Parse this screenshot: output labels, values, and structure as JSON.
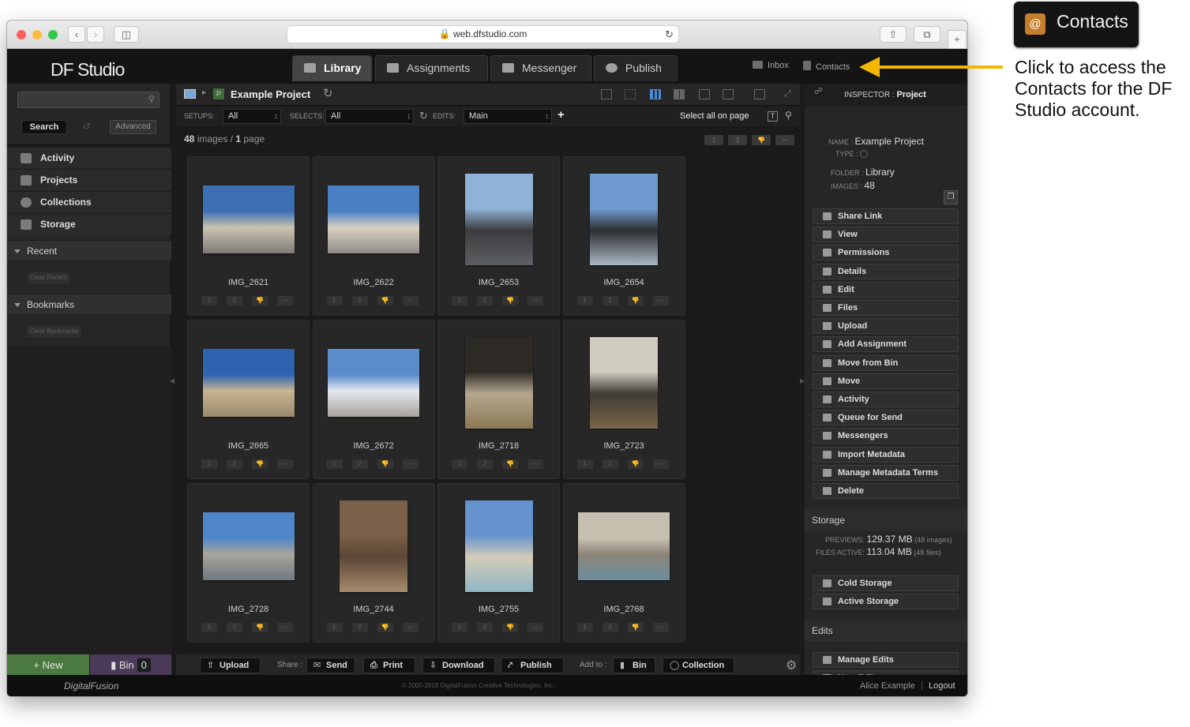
{
  "browser": {
    "url": "web.dfstudio.com"
  },
  "app": {
    "logo": "DF Studio",
    "tabs": [
      {
        "label": "Library",
        "icon": "library-icon",
        "active": true
      },
      {
        "label": "Assignments",
        "icon": "pencil-icon",
        "active": false
      },
      {
        "label": "Messenger",
        "icon": "messenger-icon",
        "active": false
      },
      {
        "label": "Publish",
        "icon": "publish-icon",
        "active": false
      }
    ],
    "inbox": "Inbox",
    "contacts": "Contacts"
  },
  "sidebar": {
    "search_button": "Search",
    "advanced_button": "Advanced",
    "nav": [
      "Activity",
      "Projects",
      "Collections",
      "Storage"
    ],
    "recent": "Recent",
    "clear_recent": "Clear Recent",
    "bookmarks": "Bookmarks",
    "clear_bookmarks": "Clear Bookmarks",
    "new_button": "+ New",
    "bin_button": "Bin",
    "bin_count": "0"
  },
  "content": {
    "project_badge": "P",
    "project_title": "Example Project",
    "setups_label": "SETUPS:",
    "setups_value": "All",
    "selects_label": "SELECTS:",
    "selects_value": "All",
    "edits_label": "EDITS:",
    "edits_value": "Main",
    "add_edit": "+",
    "select_all": "Select all on page",
    "count_images": "48",
    "count_images_label": "images",
    "count_sep": "/",
    "count_pages": "1",
    "count_pages_label": "page",
    "page_buttons": [
      "1",
      "2",
      "👎",
      "—"
    ],
    "rating_buttons": [
      "1",
      "2",
      "👎",
      "—"
    ],
    "images": [
      {
        "name": "IMG_2621",
        "orient": "l",
        "colors": [
          "#3d6fb4",
          "#c9c3b1",
          "#7d7b77"
        ]
      },
      {
        "name": "IMG_2622",
        "orient": "l",
        "colors": [
          "#4a7fc4",
          "#d8d2c2",
          "#8f8c87"
        ]
      },
      {
        "name": "IMG_2653",
        "orient": "p",
        "colors": [
          "#8fb2d6",
          "#3c3c3e",
          "#5d5f63"
        ]
      },
      {
        "name": "IMG_2654",
        "orient": "p",
        "colors": [
          "#6f9bd0",
          "#2d2e30",
          "#a9b6c3"
        ]
      },
      {
        "name": "IMG_2665",
        "orient": "l",
        "colors": [
          "#2f63b0",
          "#c8b493",
          "#9a8a6c"
        ]
      },
      {
        "name": "IMG_2672",
        "orient": "l",
        "colors": [
          "#5b8bcb",
          "#e3e9ef",
          "#a8a39a"
        ]
      },
      {
        "name": "IMG_2718",
        "orient": "p",
        "colors": [
          "#2d2a25",
          "#b5a88f",
          "#8a7754"
        ]
      },
      {
        "name": "IMG_2723",
        "orient": "p",
        "colors": [
          "#d0cbbf",
          "#3f3b34",
          "#7a6647"
        ]
      },
      {
        "name": "IMG_2728",
        "orient": "l",
        "colors": [
          "#4f86c9",
          "#a9a59b",
          "#707a80"
        ]
      },
      {
        "name": "IMG_2744",
        "orient": "p",
        "colors": [
          "#7a6048",
          "#5b4735",
          "#a88c6e"
        ]
      },
      {
        "name": "IMG_2755",
        "orient": "p",
        "colors": [
          "#6493cf",
          "#d3cbb8",
          "#8fb7c4"
        ]
      },
      {
        "name": "IMG_2768",
        "orient": "l",
        "colors": [
          "#c7c0b1",
          "#8c8578",
          "#6b8e9c"
        ]
      }
    ]
  },
  "bottombar": {
    "upload": "Upload",
    "share_label": "Share :",
    "send": "Send",
    "print": "Print",
    "download": "Download",
    "publish": "Publish",
    "add_to_label": "Add to :",
    "bin": "Bin",
    "collection": "Collection"
  },
  "inspector": {
    "title_label": "INSPECTOR :",
    "title_value": "Project",
    "name_label": "NAME :",
    "name_value": "Example Project",
    "type_label": "TYPE :",
    "folder_label": "FOLDER :",
    "folder_value": "Library",
    "images_label": "IMAGES :",
    "images_value": "48",
    "actions": [
      "Share Link",
      "View",
      "Permissions",
      "Details",
      "Edit",
      "Files",
      "Upload",
      "Add Assignment",
      "Move from Bin",
      "Move",
      "Activity",
      "Queue for Send",
      "Messengers",
      "Import Metadata",
      "Manage Metadata Terms",
      "Delete"
    ],
    "storage_heading": "Storage",
    "previews_label": "PREVIEWS:",
    "previews_value": "129.37 MB",
    "previews_note": "(48 images)",
    "files_label": "FILES ACTIVE:",
    "files_value": "113.04 MB",
    "files_note": "(48 files)",
    "storage_actions": [
      "Cold Storage",
      "Active Storage"
    ],
    "edits_heading": "Edits",
    "edits_actions": [
      "Manage Edits",
      "New Edit"
    ]
  },
  "footer": {
    "logo": "DigitalFusion",
    "copyright": "© 2000-2018 DigitalFusion Creative Technologies, Inc.",
    "user": "Alice Example",
    "logout": "Logout"
  },
  "callout": {
    "badge_label": "Contacts",
    "text": "Click to access the Contacts for the DF Studio account.",
    "arrow_color": "#f2b705"
  }
}
